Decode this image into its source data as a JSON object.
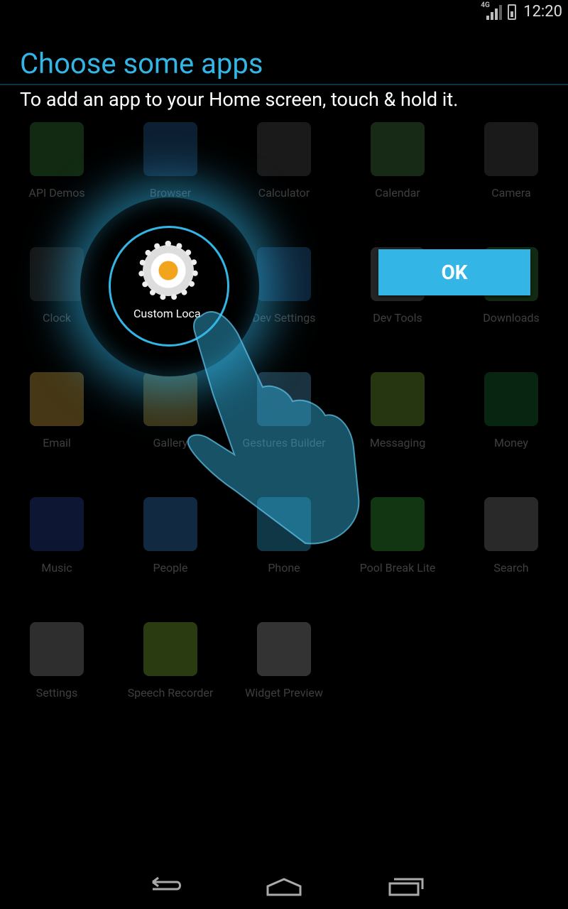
{
  "status_bar": {
    "network": "4G",
    "time": "12:20"
  },
  "header": {
    "title": "Choose some apps",
    "subtitle": "To add an app to your Home screen, touch & hold it."
  },
  "apps": [
    {
      "label": "API Demos",
      "icon": "folder-icon",
      "color": "#3a8a3a"
    },
    {
      "label": "Browser",
      "icon": "globe-icon",
      "color": "#2a6aa8"
    },
    {
      "label": "Calculator",
      "icon": "calculator-icon",
      "color": "#555555"
    },
    {
      "label": "Calendar",
      "icon": "calendar-icon",
      "color": "#4a8a4a"
    },
    {
      "label": "Camera",
      "icon": "camera-icon",
      "color": "#555555"
    },
    {
      "label": "Clock",
      "icon": "clock-icon",
      "color": "#444444"
    },
    {
      "label": "Custom Locale",
      "icon": "gear-icon",
      "color": "#cccccc"
    },
    {
      "label": "Dev Settings",
      "icon": "sliders-icon",
      "color": "#2a6aa8"
    },
    {
      "label": "Dev Tools",
      "icon": "gear-icon",
      "color": "#777777"
    },
    {
      "label": "Downloads",
      "icon": "download-icon",
      "color": "#3a8a3a"
    },
    {
      "label": "Email",
      "icon": "email-icon",
      "color": "#e8b84a"
    },
    {
      "label": "Gallery",
      "icon": "gallery-icon",
      "color": "#c8a84a"
    },
    {
      "label": "Gestures Builder",
      "icon": "gestures-icon",
      "color": "#5aa8d8"
    },
    {
      "label": "Messaging",
      "icon": "message-icon",
      "color": "#7ab43a"
    },
    {
      "label": "Money",
      "icon": "chart-icon",
      "color": "#1a7a3a"
    },
    {
      "label": "Music",
      "icon": "speaker-icon",
      "color": "#2a4aa8"
    },
    {
      "label": "People",
      "icon": "contact-icon",
      "color": "#3a8ad8"
    },
    {
      "label": "Phone",
      "icon": "phone-icon",
      "color": "#33b5e5"
    },
    {
      "label": "Pool Break Lite",
      "icon": "pool-icon",
      "color": "#3ab43a"
    },
    {
      "label": "Search",
      "icon": "magnifier-icon",
      "color": "#888888"
    },
    {
      "label": "Settings",
      "icon": "gear-icon",
      "color": "#999999"
    },
    {
      "label": "Speech Recorder",
      "icon": "android-icon",
      "color": "#8ac43a"
    },
    {
      "label": "Widget Preview",
      "icon": "widget-icon",
      "color": "#aaaaaa"
    }
  ],
  "focus": {
    "app_label": "Custom Loca",
    "icon": "gear-icon"
  },
  "ok_button": {
    "label": "OK"
  },
  "accent_color": "#33b5e5",
  "navbar": {
    "back": "back-icon",
    "home": "home-icon",
    "recents": "recents-icon"
  }
}
